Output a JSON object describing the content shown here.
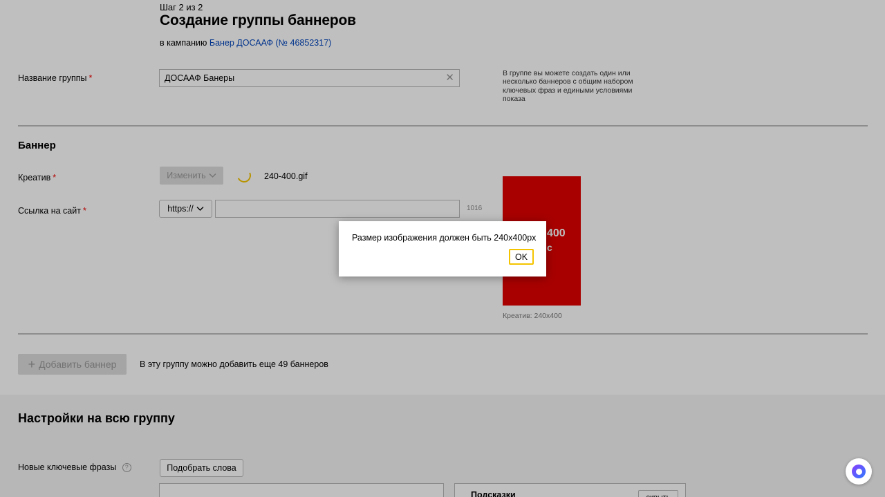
{
  "header": {
    "step": "Шаг 2 из 2",
    "title": "Создание группы баннеров",
    "campaign_prefix": "в кампанию",
    "campaign_link": "Банер ДОСААФ (№ 46852317)"
  },
  "group_name": {
    "label": "Название группы",
    "required_mark": "*",
    "value": "ДОСААФ Банеры",
    "clear_icon": "✕",
    "hint": "В группе вы можете создать один или несколько баннеров с общим набором ключевых фраз и едиными условиями показа"
  },
  "banner": {
    "section_title": "Баннер",
    "creative_label": "Креатив",
    "change_button": "Изменить",
    "file_name": "240-400.gif",
    "url_label": "Ссылка на сайт",
    "protocol": "https://",
    "url_value": "",
    "char_counter": "1016",
    "preview_text_line1": "400",
    "preview_text_line2": "с",
    "creative_caption": "Креатив: 240х400"
  },
  "add_banner": {
    "button_label": "Добавить баннер",
    "note": "В эту группу можно добавить еще 49 баннеров"
  },
  "group_settings": {
    "section_title": "Настройки на всю группу",
    "keywords_label": "Новые ключевые фразы",
    "help_icon": "?",
    "pick_words_button": "Подобрать слова",
    "hints_title": "Подсказки",
    "hide_button": "скрыть"
  },
  "dialog": {
    "message": "Размер изображения должен быть 240x400px",
    "ok_label": "OK"
  },
  "colors": {
    "link": "#0044bb",
    "required": "#e00000",
    "accent_yellow": "#f5c400",
    "banner_red": "#e00000"
  },
  "icons": {
    "clear": "clear-icon",
    "chevron": "chevron-down-icon",
    "plus": "plus-icon",
    "spinner": "loading-spinner-icon",
    "help": "help-circle-icon",
    "assistant": "alice-assistant-icon"
  }
}
